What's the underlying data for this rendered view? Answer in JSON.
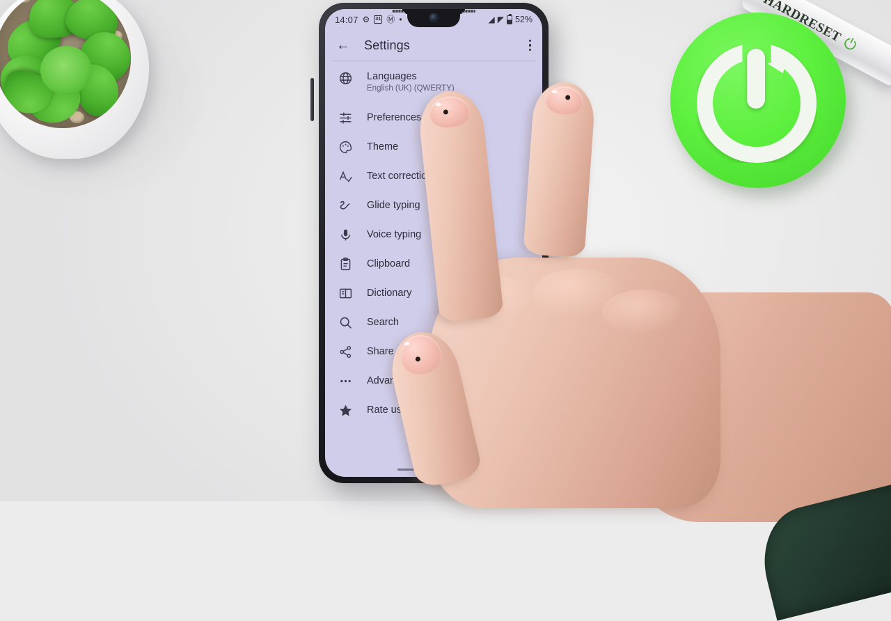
{
  "scene": {
    "description": "hand holding smartphone on white desk",
    "branding": {
      "pen_text": "HARDRESET",
      "pen_icon": "power-icon",
      "disc_icon": "power-icon",
      "disc_color": "#5ef03f"
    },
    "plant": {
      "name": "succulent-plant",
      "pot_color": "#f4f4f5",
      "leaf_color": "#4cb32e"
    }
  },
  "phone": {
    "status_bar": {
      "time": "14:07",
      "left_icons": [
        "gear-icon",
        "calendar-icon",
        "gmail-icon",
        "dot-icon"
      ],
      "calendar_day": "31",
      "right_icons": [
        "wifi-icon",
        "signal-icon",
        "battery-icon"
      ],
      "battery_percent": "52%"
    },
    "toolbar": {
      "back_icon": "back-arrow-icon",
      "title": "Settings",
      "more_icon": "overflow-menu-icon"
    },
    "settings_list": [
      {
        "icon": "globe-icon",
        "title": "Languages",
        "subtitle": "English (UK) (QWERTY)"
      },
      {
        "icon": "sliders-icon",
        "title": "Preferences",
        "subtitle": ""
      },
      {
        "icon": "palette-icon",
        "title": "Theme",
        "subtitle": ""
      },
      {
        "icon": "spellcheck-icon",
        "title": "Text correction",
        "subtitle": ""
      },
      {
        "icon": "glide-icon",
        "title": "Glide typing",
        "subtitle": ""
      },
      {
        "icon": "microphone-icon",
        "title": "Voice typing",
        "subtitle": ""
      },
      {
        "icon": "clipboard-icon",
        "title": "Clipboard",
        "subtitle": ""
      },
      {
        "icon": "dictionary-icon",
        "title": "Dictionary",
        "subtitle": ""
      },
      {
        "icon": "search-icon",
        "title": "Search",
        "subtitle": ""
      },
      {
        "icon": "share-icon",
        "title": "Share",
        "subtitle": ""
      },
      {
        "icon": "more-horiz-icon",
        "title": "Advanced",
        "subtitle": ""
      },
      {
        "icon": "star-icon",
        "title": "Rate us",
        "subtitle": ""
      }
    ],
    "nav": {
      "home_indicator": "gesture-home-indicator"
    },
    "screen_color": "#cfcdea"
  }
}
